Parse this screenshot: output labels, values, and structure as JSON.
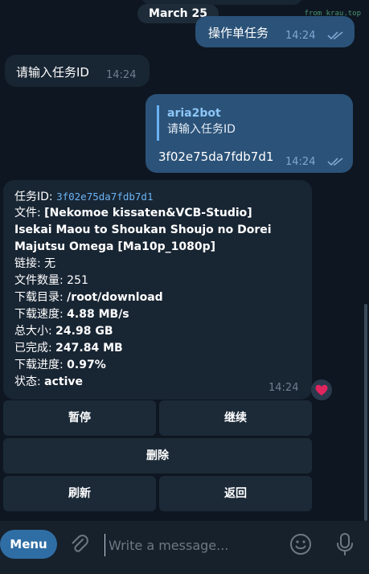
{
  "watermark": "from krau.top",
  "date_divider": "March 25",
  "messages": {
    "out1": {
      "text": "操作单任务",
      "time": "14:24"
    },
    "in1": {
      "text": "请输入任务ID",
      "time": "14:24"
    },
    "out2": {
      "reply_name": "aria2bot",
      "reply_text": "请输入任务ID",
      "text": "3f02e75da7fdb7d1",
      "time": "14:24"
    },
    "info": {
      "task_id_label": "任务ID: ",
      "task_id": "3f02e75da7fdb7d1",
      "file_label": "文件: ",
      "file_line1": "[Nekomoe kissaten&VCB-Studio]",
      "file_line2": "Isekai Maou to Shoukan Shoujo no Dorei",
      "file_line3": "Majutsu Omega [Ma10p_1080p]",
      "link_label": "链接: ",
      "link_value": "无",
      "count_label": "文件数量: ",
      "count_value": "251",
      "dir_label": "下载目录: ",
      "dir_value": "/root/download",
      "speed_label": "下载速度: ",
      "speed_value": "4.88 MB/s",
      "size_label": "总大小: ",
      "size_value": "24.98 GB",
      "done_label": "已完成: ",
      "done_value": "247.84 MB",
      "progress_label": "下载进度: ",
      "progress_value": "0.97%",
      "status_label": "状态: ",
      "status_value": "active",
      "time": "14:24"
    }
  },
  "keyboard": {
    "pause": "暂停",
    "resume": "继续",
    "delete": "删除",
    "refresh": "刷新",
    "back": "返回"
  },
  "composer": {
    "menu_label": "Menu",
    "placeholder": "Write a message..."
  },
  "colors": {
    "background": "#0e1621",
    "bubble_out": "#2b5278",
    "bubble_in": "#182533",
    "accent": "#6ab3f3",
    "reaction_heart": "#e0245e"
  },
  "icons": [
    "double-check-icon",
    "heart-icon",
    "paperclip-icon",
    "emoji-icon",
    "microphone-icon"
  ]
}
